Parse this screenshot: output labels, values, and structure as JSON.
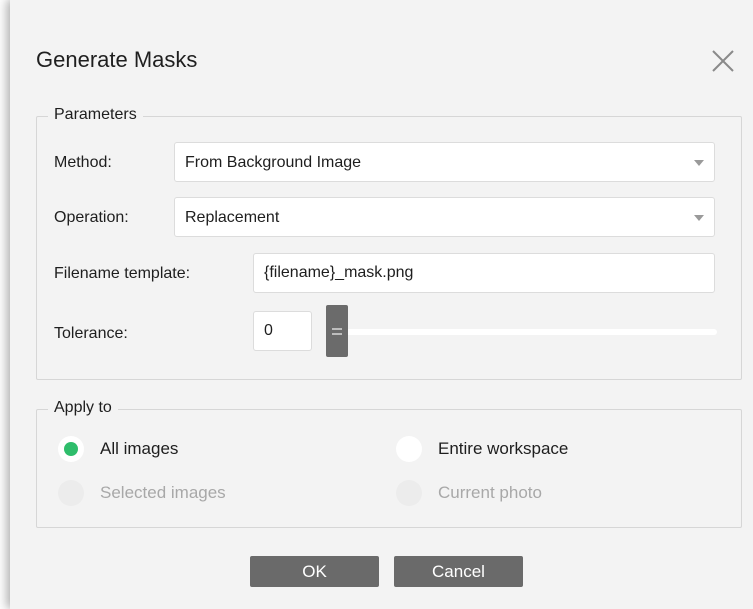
{
  "dialog": {
    "title": "Generate Masks"
  },
  "parameters": {
    "label": "Parameters",
    "method": {
      "label": "Method:",
      "value": "From Background Image"
    },
    "operation": {
      "label": "Operation:",
      "value": "Replacement"
    },
    "filename_template": {
      "label": "Filename template:",
      "value": "{filename}_mask.png"
    },
    "tolerance": {
      "label": "Tolerance:",
      "value": "0",
      "slider_fraction": 0
    }
  },
  "apply_to": {
    "label": "Apply to",
    "options": [
      {
        "label": "All images",
        "selected": true,
        "enabled": true
      },
      {
        "label": "Entire workspace",
        "selected": false,
        "enabled": true
      },
      {
        "label": "Selected images",
        "selected": false,
        "enabled": false
      },
      {
        "label": "Current photo",
        "selected": false,
        "enabled": false
      }
    ]
  },
  "buttons": {
    "ok": "OK",
    "cancel": "Cancel"
  },
  "colors": {
    "accent": "#2ebd6b",
    "button_bg": "#6a6a6a",
    "dialog_bg": "#f3f3f3"
  },
  "icons": {
    "close": "close-icon",
    "dropdown": "chevron-down-icon"
  }
}
